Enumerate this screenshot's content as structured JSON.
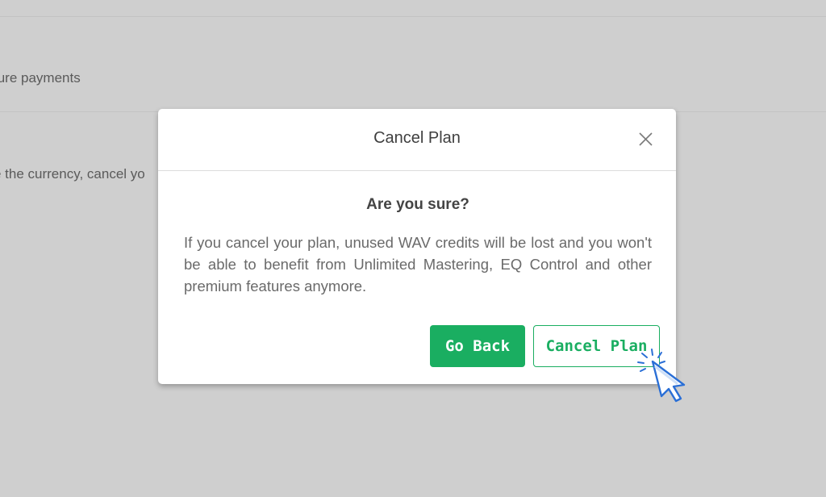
{
  "background": {
    "line1": "ture payments",
    "line2": "e the currency, cancel yo"
  },
  "modal": {
    "title": "Cancel Plan",
    "close_icon": "close-icon",
    "heading": "Are you sure?",
    "message": "If you cancel your plan, unused WAV credits will be lost and you won't be able to benefit from Unlimited Mastering, EQ Control and other premium features anymore.",
    "buttons": {
      "go_back_label": "Go Back",
      "cancel_plan_label": "Cancel Plan"
    }
  },
  "cursor_icon": "pointer-cursor-icon",
  "colors": {
    "accent": "#1aae61",
    "backdrop": "#cfcfcf",
    "cursor": "#2a6fd6"
  }
}
